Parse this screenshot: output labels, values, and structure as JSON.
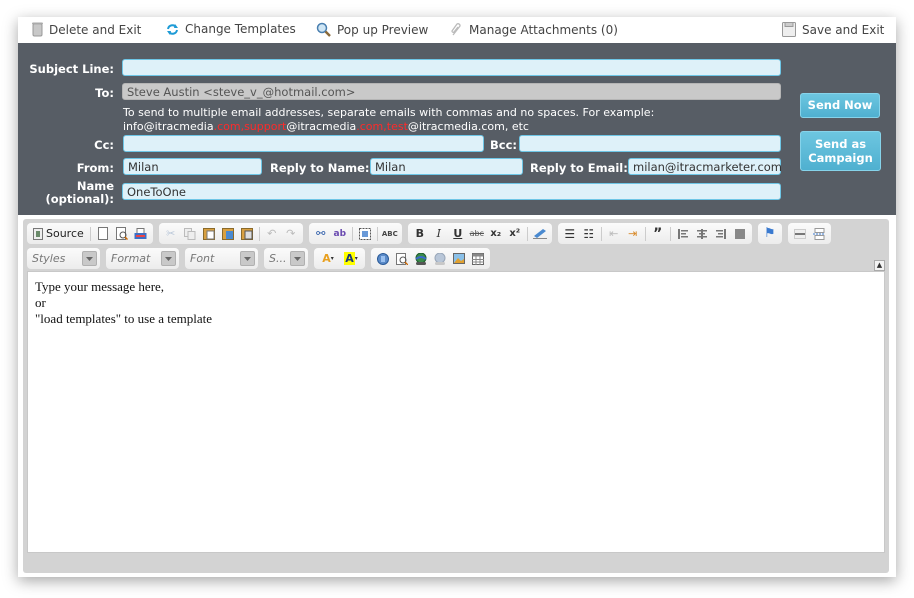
{
  "topbar": {
    "delete_exit": "Delete and Exit",
    "change_templates": "Change Templates",
    "popup_preview": "Pop up Preview",
    "manage_attachments": "Manage Attachments (0)",
    "save_exit": "Save and Exit"
  },
  "form": {
    "subject_label": "Subject Line:",
    "subject_value": "",
    "to_label": "To:",
    "to_value": "Steve Austin <steve_v_@hotmail.com>",
    "hint_line1": "To send to multiple email addresses, separate emails with commas and no spaces. For example:",
    "hint_parts": [
      "info@itracmedia",
      ".com,support",
      "@itracmedia",
      ".com,test",
      "@itracmedia.com, etc"
    ],
    "cc_label": "Cc:",
    "cc_value": "",
    "bcc_label": "Bcc:",
    "bcc_value": "",
    "from_label": "From:",
    "from_value": "Milan",
    "reply_name_label": "Reply to Name:",
    "reply_name_value": "Milan",
    "reply_email_label": "Reply to Email:",
    "reply_email_value": "milan@itracmarketer.com",
    "name_label_1": "Name",
    "name_label_2": "(optional):",
    "name_value": "OneToOne"
  },
  "actions": {
    "send_now": "Send Now",
    "send_campaign_1": "Send as",
    "send_campaign_2": "Campaign"
  },
  "editor": {
    "source_label": "Source",
    "styles": "Styles",
    "format": "Format",
    "font": "Font",
    "size": "S...",
    "bold": "B",
    "italic": "I",
    "underline": "U",
    "strike": "abc",
    "subscript": "x₂",
    "superscript": "x²",
    "quote": "”",
    "content_lines": [
      "Type your message here,",
      "or",
      "\"load templates\" to use a template"
    ]
  },
  "colors": {
    "header_bg": "#575d65",
    "field_bg": "#def1f9",
    "field_border": "#6ec6e6",
    "button": "#58b7d6",
    "hint_red": "#ff2a2a"
  }
}
